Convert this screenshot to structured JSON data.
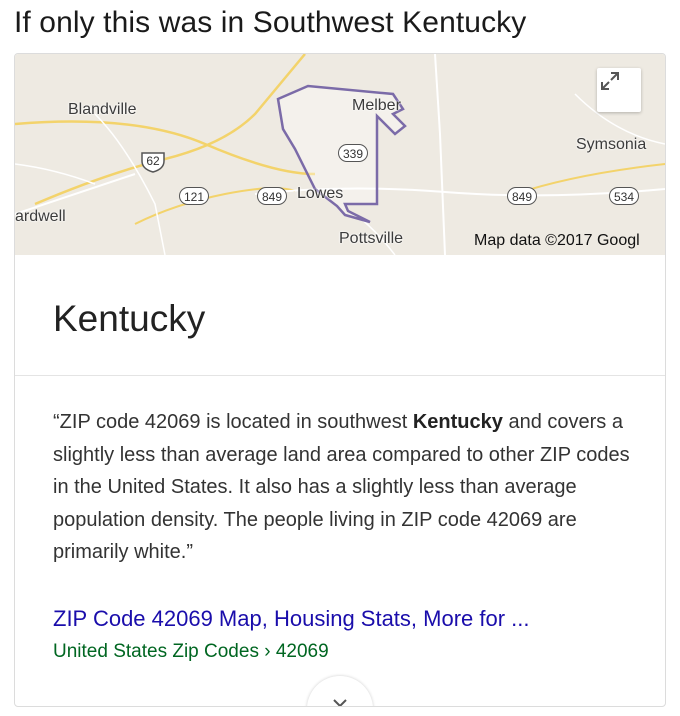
{
  "post": {
    "caption": "If only this was in Southwest Kentucky"
  },
  "map": {
    "places": {
      "blandville": "Blandville",
      "melber": "Melber",
      "symsonia": "Symsonia",
      "lowes": "Lowes",
      "bardwell": "ardwell",
      "pottsville": "Pottsville"
    },
    "routes": {
      "us62": "62",
      "r121": "121",
      "r849a": "849",
      "r849b": "849",
      "r339": "339",
      "r534": "534"
    },
    "attribution": "Map data ©2017 Googl",
    "expand_icon": "expand-icon"
  },
  "result": {
    "title": "Kentucky",
    "quote_open": "“",
    "description_part1": "ZIP code 42069 is located in southwest ",
    "description_bold": "Kentucky",
    "description_part2": " and covers a slightly less than average land area compared to other ZIP codes in the United States. It also has a slightly less than average population density. The people living in ZIP code 42069 are primarily white.",
    "quote_close": "”",
    "link_title": "ZIP Code 42069 Map, Housing Stats, More for ...",
    "link_url": "United States Zip Codes › 42069",
    "more_icon": "chevron-down-icon"
  },
  "colors": {
    "link": "#1a0dab",
    "url": "#006621",
    "boundary": "#7b6ba8",
    "map_bg": "#eeeae2"
  }
}
